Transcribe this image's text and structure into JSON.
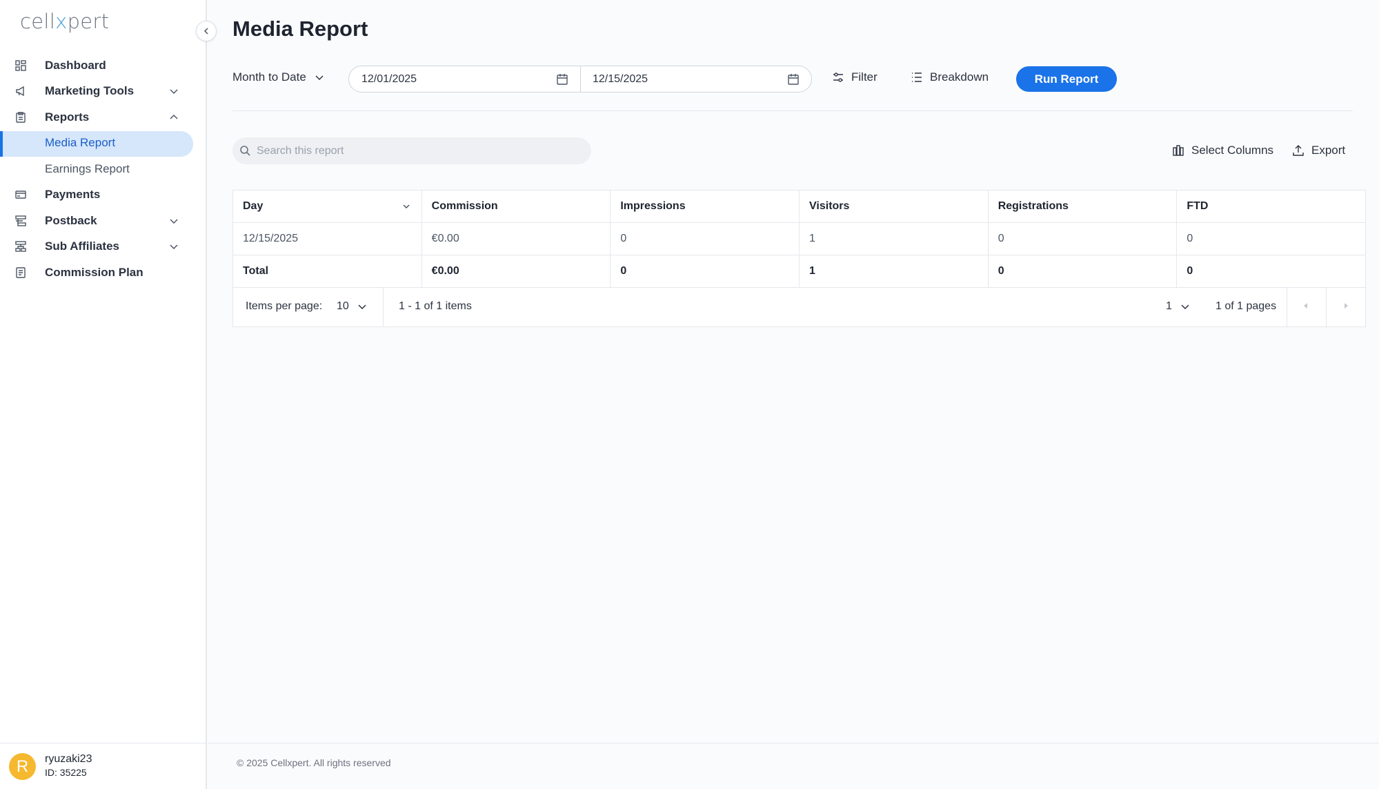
{
  "brand": {
    "logo_pre": "cell",
    "logo_x": "x",
    "logo_post": "pert"
  },
  "sidebar": {
    "items": [
      {
        "label": "Dashboard",
        "icon": "dashboard-icon"
      },
      {
        "label": "Marketing Tools",
        "icon": "megaphone-icon",
        "expandable": true,
        "expanded": false
      },
      {
        "label": "Reports",
        "icon": "clipboard-icon",
        "expandable": true,
        "expanded": true
      },
      {
        "label": "Media Report",
        "sub": true,
        "active": true
      },
      {
        "label": "Earnings Report",
        "sub": true
      },
      {
        "label": "Payments",
        "icon": "card-icon"
      },
      {
        "label": "Postback",
        "icon": "postback-icon",
        "expandable": true,
        "expanded": false
      },
      {
        "label": "Sub Affiliates",
        "icon": "hierarchy-icon",
        "expandable": true,
        "expanded": false
      },
      {
        "label": "Commission Plan",
        "icon": "document-icon"
      }
    ]
  },
  "user": {
    "initial": "R",
    "name": "ryuzaki23",
    "id": "ID: 35225"
  },
  "page": {
    "title": "Media Report"
  },
  "toolbar": {
    "period": "Month to Date",
    "start_date": "12/01/2025",
    "end_date": "12/15/2025",
    "filter_label": "Filter",
    "breakdown_label": "Breakdown",
    "run_label": "Run Report"
  },
  "search": {
    "placeholder": "Search this report"
  },
  "actions": {
    "select_columns": "Select Columns",
    "export": "Export"
  },
  "table": {
    "columns": [
      "Day",
      "Commission",
      "Impressions",
      "Visitors",
      "Registrations",
      "FTD"
    ],
    "rows": [
      [
        "12/15/2025",
        "€0.00",
        "0",
        "1",
        "0",
        "0"
      ]
    ],
    "total": [
      "Total",
      "€0.00",
      "0",
      "1",
      "0",
      "0"
    ]
  },
  "pagination": {
    "items_per_page_label": "Items per page:",
    "items_per_page": "10",
    "range": "1 - 1 of 1 items",
    "current_page": "1",
    "pages": "1 of 1 pages"
  },
  "footer": {
    "copyright": "© 2025 Cellxpert. All rights reserved"
  },
  "colors": {
    "accent": "#1a73e8",
    "active_bg": "#d6e6fb",
    "avatar": "#f5b82e"
  }
}
